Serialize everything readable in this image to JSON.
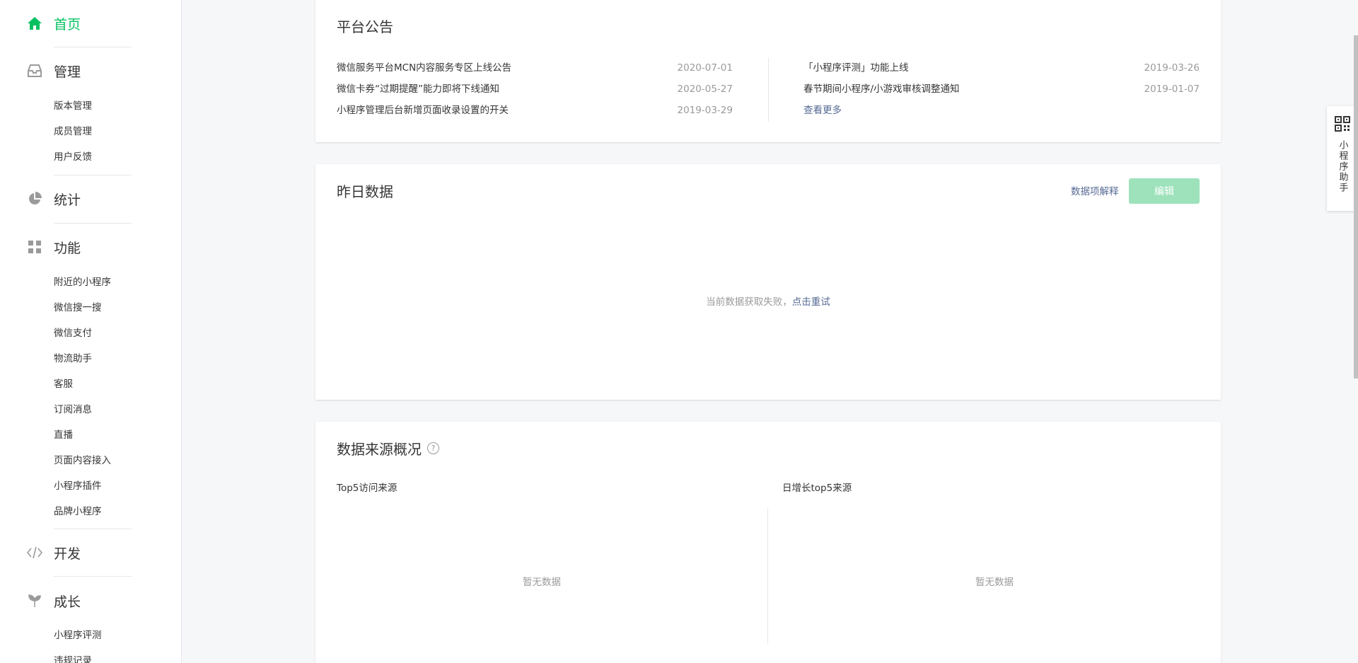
{
  "sidebar": {
    "home": "首页",
    "manage": {
      "label": "管理",
      "items": [
        "版本管理",
        "成员管理",
        "用户反馈"
      ]
    },
    "stats": {
      "label": "统计"
    },
    "features": {
      "label": "功能",
      "items": [
        "附近的小程序",
        "微信搜一搜",
        "微信支付",
        "物流助手",
        "客服",
        "订阅消息",
        "直播",
        "页面内容接入",
        "小程序插件",
        "品牌小程序"
      ]
    },
    "dev": {
      "label": "开发"
    },
    "growth": {
      "label": "成长",
      "items": [
        "小程序评测",
        "违规记录"
      ]
    }
  },
  "announcements": {
    "title": "平台公告",
    "left": [
      {
        "title": "微信服务平台MCN内容服务专区上线公告",
        "date": "2020-07-01"
      },
      {
        "title": "微信卡券“过期提醒”能力即将下线通知",
        "date": "2020-05-27"
      },
      {
        "title": "小程序管理后台新增页面收录设置的开关",
        "date": "2019-03-29"
      }
    ],
    "right": [
      {
        "title": "「小程序评测」功能上线",
        "date": "2019-03-26"
      },
      {
        "title": "春节期间小程序/小游戏审核调整通知",
        "date": "2019-01-07"
      }
    ],
    "more": "查看更多"
  },
  "yesterday": {
    "title": "昨日数据",
    "explain_link": "数据项解释",
    "edit_button": "编辑",
    "error_text": "当前数据获取失败，",
    "retry_link": "点击重试"
  },
  "sources": {
    "title": "数据来源概况",
    "help_icon": "?",
    "left_title": "Top5访问来源",
    "right_title": "日增长top5来源",
    "left_empty": "暂无数据",
    "right_empty": "暂无数据"
  },
  "helper": {
    "label": "小程序助手"
  },
  "colors": {
    "accent": "#07c160",
    "link": "#576b95",
    "disabled_button": "#9de2bb"
  }
}
